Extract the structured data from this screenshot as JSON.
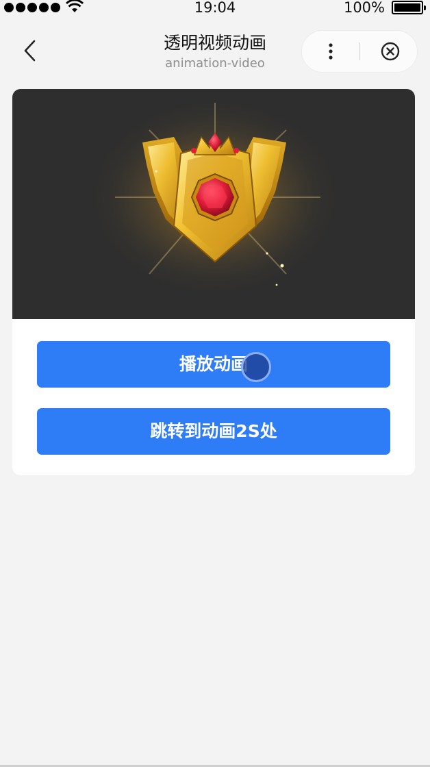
{
  "status_bar": {
    "time": "19:04",
    "battery_percent": "100%",
    "signal_icon": "signal-dots-icon",
    "wifi_icon": "wifi-icon",
    "battery_icon": "battery-icon",
    "battery_level": 1.0
  },
  "nav": {
    "title": "透明视频动画",
    "subtitle": "animation-video",
    "back_icon": "chevron-left-icon",
    "more_icon": "more-vertical-icon",
    "close_icon": "close-circle-icon"
  },
  "video": {
    "content": "gold-badge-ruby-animation",
    "background_color": "#2e2e2e"
  },
  "buttons": {
    "play_label": "播放动画",
    "seek_label": "跳转到动画2S处"
  },
  "colors": {
    "accent": "#2f7df6",
    "page_background": "#f3f3f3",
    "card_background": "#ffffff"
  }
}
